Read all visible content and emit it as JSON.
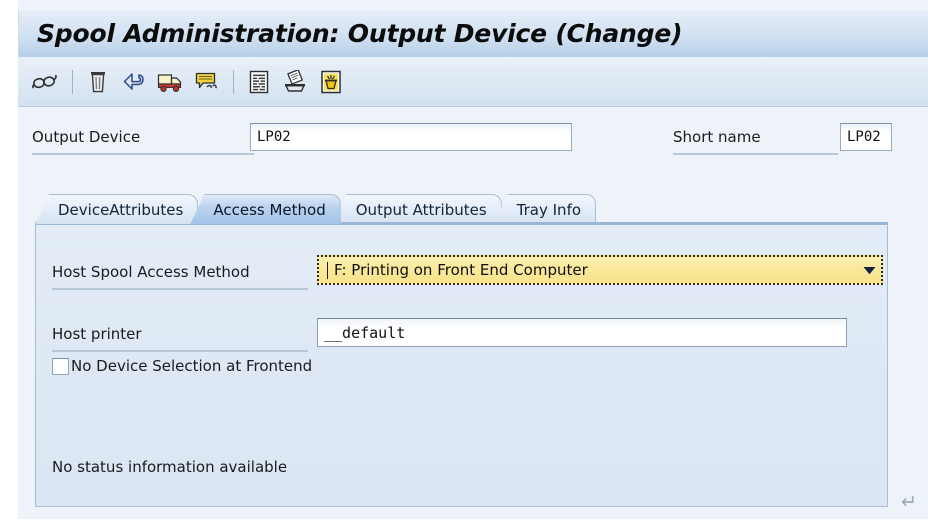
{
  "window": {
    "title": "Spool Administration: Output Device (Change)"
  },
  "toolbar": {
    "buttons": [
      {
        "name": "display-glasses-icon",
        "label": "Display",
        "glyph": "6σ"
      },
      {
        "name": "delete-trash-icon",
        "label": "Delete"
      },
      {
        "name": "undo-arrow-icon",
        "label": "Undo"
      },
      {
        "name": "delivery-truck-icon",
        "label": "Transport"
      },
      {
        "name": "tag-note-icon",
        "label": "Long Text"
      },
      {
        "name": "list-document-icon",
        "label": "Spool Requests"
      },
      {
        "name": "printer-output-icon",
        "label": "Output Requests"
      },
      {
        "name": "device-status-icon",
        "label": "Device Status"
      }
    ]
  },
  "header": {
    "output_device_label": "Output Device",
    "output_device_value": "LP02",
    "short_name_label": "Short name",
    "short_name_value": "LP02"
  },
  "tabs": [
    {
      "label": "DeviceAttributes",
      "active": false
    },
    {
      "label": "Access Method",
      "active": true
    },
    {
      "label": "Output Attributes",
      "active": false
    },
    {
      "label": "Tray Info",
      "active": false
    }
  ],
  "access_method": {
    "host_spool_access_method_label": "Host Spool Access Method",
    "host_spool_access_method_value": "F: Printing on Front End Computer",
    "host_printer_label": "Host printer",
    "host_printer_value": "__default",
    "no_device_selection_label": "No Device Selection at Frontend",
    "no_device_selection_checked": false,
    "status_text": "No status information available"
  },
  "footer": {
    "enter_glyph": "↵"
  },
  "colors": {
    "title_bar_start": "#e6eef8",
    "title_bar_end": "#b6cde8",
    "combo_highlight": "#f8e38b",
    "panel_bg": "#dfe9f5",
    "active_tab": "#a3c5e9",
    "border": "#a8bdd4"
  }
}
